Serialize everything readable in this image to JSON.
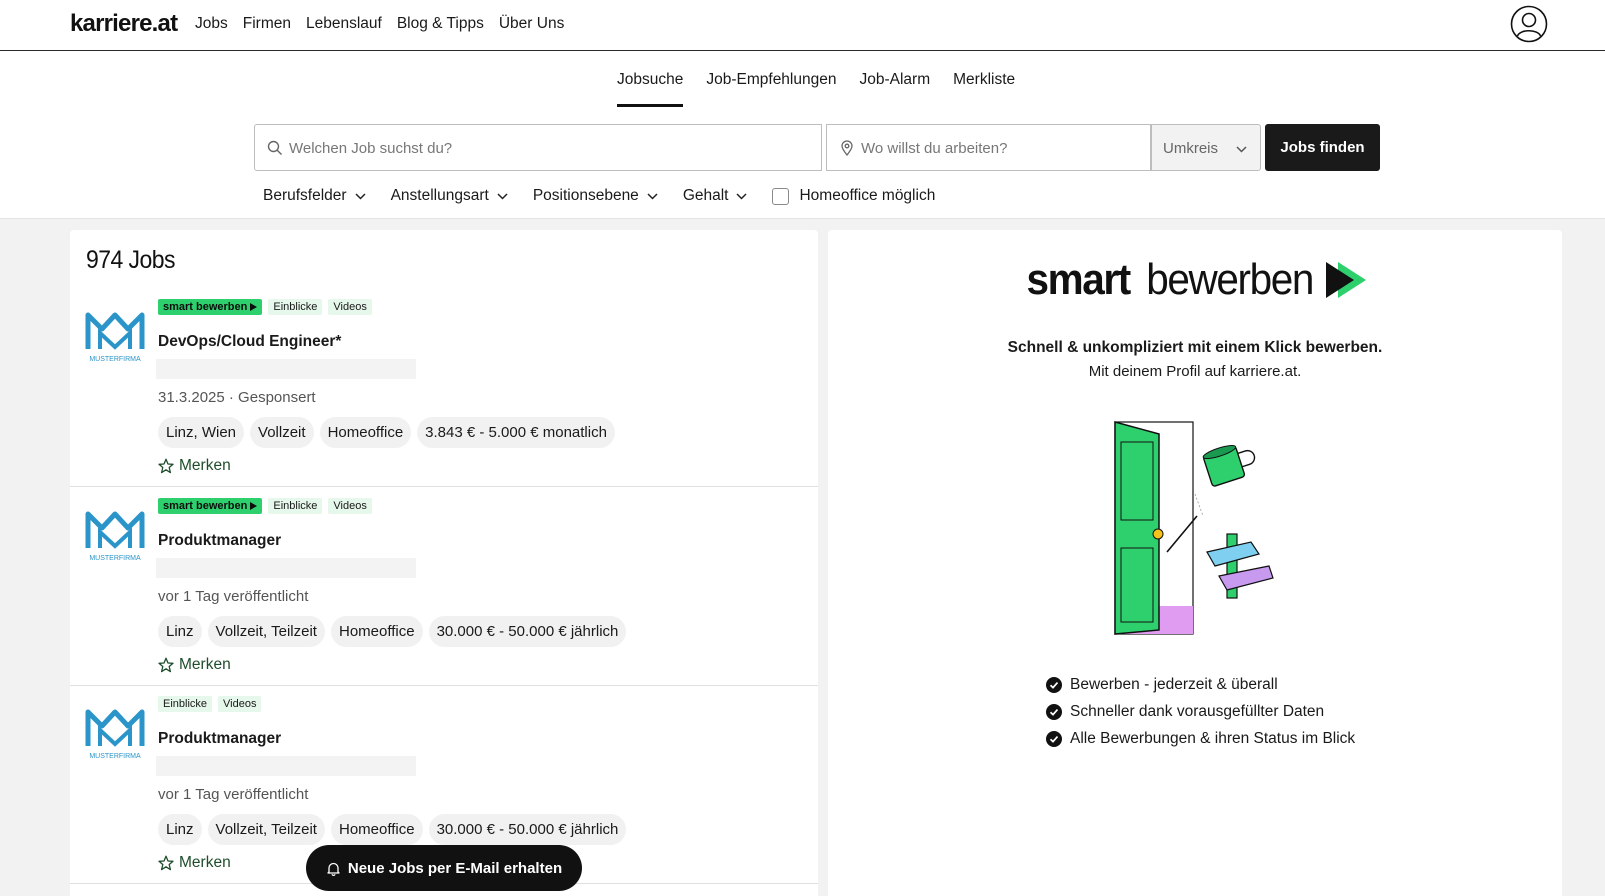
{
  "header": {
    "logo": "karriere.at",
    "nav": [
      "Jobs",
      "Firmen",
      "Lebenslauf",
      "Blog & Tipps",
      "Über Uns"
    ]
  },
  "subnav": {
    "tabs": [
      "Jobsuche",
      "Job-Empfehlungen",
      "Job-Alarm",
      "Merkliste"
    ],
    "active": "Jobsuche"
  },
  "search": {
    "job_placeholder": "Welchen Job suchst du?",
    "location_placeholder": "Wo willst du arbeiten?",
    "radius_label": "Umkreis",
    "submit_label": "Jobs finden"
  },
  "filters": {
    "items": [
      "Berufsfelder",
      "Anstellungsart",
      "Positionsebene",
      "Gehalt"
    ],
    "homeoffice_label": "Homeoffice möglich"
  },
  "results": {
    "count_label": "974 Jobs",
    "jobs": [
      {
        "badges": [
          "smart bewerben",
          "Einblicke",
          "Videos"
        ],
        "title": "DevOps/Cloud Engineer*",
        "meta": "31.3.2025 · Gesponsert",
        "tags": [
          "Linz, Wien",
          "Vollzeit",
          "Homeoffice",
          "3.843 € - 5.000 € monatlich"
        ],
        "save_label": "Merken",
        "company_logo_text": "MUSTERFIRMA"
      },
      {
        "badges": [
          "smart bewerben",
          "Einblicke",
          "Videos"
        ],
        "title": "Produktmanager",
        "meta": "vor 1 Tag veröffentlicht",
        "tags": [
          "Linz",
          "Vollzeit, Teilzeit",
          "Homeoffice",
          "30.000 € - 50.000 € jährlich"
        ],
        "save_label": "Merken",
        "company_logo_text": "MUSTERFIRMA"
      },
      {
        "badges": [
          "Einblicke",
          "Videos"
        ],
        "title": "Produktmanager",
        "meta": "vor 1 Tag veröffentlicht",
        "tags": [
          "Linz",
          "Vollzeit, Teilzeit",
          "Homeoffice",
          "30.000 € - 50.000 € jährlich"
        ],
        "save_label": "Merken",
        "company_logo_text": "MUSTERFIRMA"
      }
    ],
    "email_alert_label": "Neue Jobs per E-Mail erhalten"
  },
  "promo": {
    "logo_bold": "smart",
    "logo_regular": "bewerben",
    "headline": "Schnell & unkompliziert mit einem Klick bewerben.",
    "subline": "Mit deinem Profil auf karriere.at.",
    "benefits": [
      "Bewerben - jederzeit & überall",
      "Schneller dank vorausgefüllter Daten",
      "Alle Bewerbungen & ihren Status im Blick"
    ]
  },
  "colors": {
    "brand_green": "#2ed06e",
    "dark": "#111111"
  }
}
